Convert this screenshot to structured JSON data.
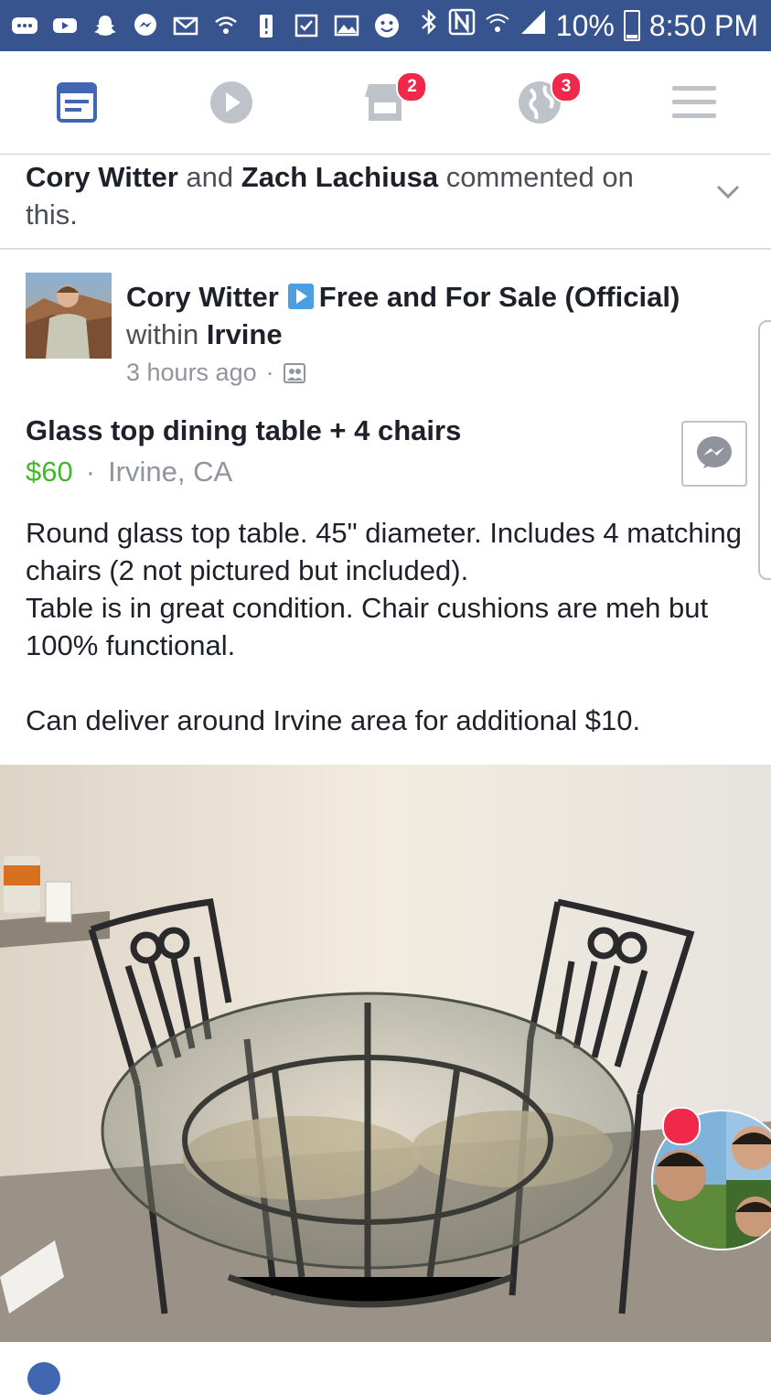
{
  "status_bar": {
    "battery": "10%",
    "time": "8:50 PM",
    "icons": [
      "more-icon",
      "youtube-icon",
      "snapchat-icon",
      "messenger-icon",
      "gmail-icon",
      "wifi-call-icon",
      "alert-icon",
      "task-icon",
      "gallery-icon",
      "smiley-icon",
      "bluetooth-icon",
      "nfc-icon",
      "wifi-icon",
      "signal-icon",
      "battery-icon"
    ]
  },
  "nav": {
    "items": [
      {
        "name": "news-feed",
        "active": true,
        "badge": ""
      },
      {
        "name": "watch",
        "active": false,
        "badge": ""
      },
      {
        "name": "marketplace",
        "active": false,
        "badge": "2"
      },
      {
        "name": "notifications",
        "active": false,
        "badge": "3"
      },
      {
        "name": "menu",
        "active": false,
        "badge": ""
      }
    ]
  },
  "activity": {
    "user1": "Cory Witter",
    "connector": "and",
    "user2": "Zach Lachiusa",
    "suffix": "commented on this."
  },
  "post": {
    "author": "Cory Witter",
    "group": "Free and For Sale (Official)",
    "within_label": "within",
    "within_place": "Irvine",
    "time": "3 hours ago",
    "separator": "·",
    "listing": {
      "title": "Glass top dining table + 4 chairs",
      "price": "$60",
      "location": "Irvine, CA"
    },
    "description": "Round glass top table. 45\" diameter. Includes 4 matching chairs (2 not pictured but included).\nTable is in great condition. Chair cushions are meh but 100% functional.\n\nCan deliver around Irvine area for additional $10."
  },
  "colors": {
    "status_bar": "#38548f",
    "accent": "#4267b2",
    "price": "#42b72a",
    "badge": "#f02849"
  }
}
